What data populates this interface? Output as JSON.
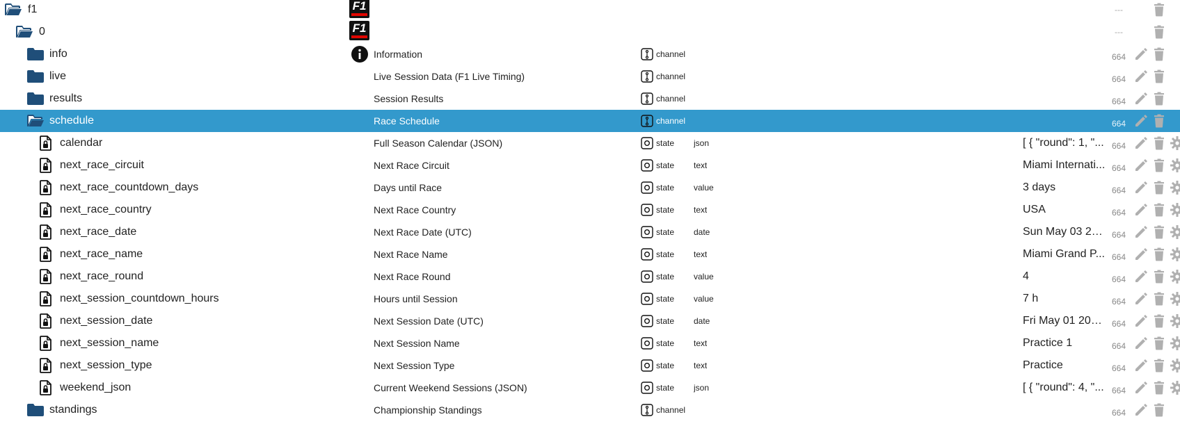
{
  "acl_placeholder": "---",
  "colors": {
    "selected_bg": "#3399cc",
    "folder": "#1f4e79",
    "icon_grey": "#b0b0b0"
  },
  "rows": [
    {
      "name": "f1",
      "level": 0,
      "kind": "folder-open",
      "logo": true,
      "acl": "---",
      "actions": "trash"
    },
    {
      "name": "0",
      "level": 1,
      "kind": "folder-open",
      "logo": true,
      "acl": "---",
      "actions": "trash"
    },
    {
      "name": "info",
      "level": 2,
      "kind": "folder",
      "info_icon": true,
      "desc": "Information",
      "role": "channel",
      "acl": "664",
      "actions": "edit"
    },
    {
      "name": "live",
      "level": 2,
      "kind": "folder",
      "desc": "Live Session Data (F1 Live Timing)",
      "role": "channel",
      "acl": "664",
      "actions": "edit"
    },
    {
      "name": "results",
      "level": 2,
      "kind": "folder",
      "desc": "Session Results",
      "role": "channel",
      "acl": "664",
      "actions": "edit"
    },
    {
      "name": "schedule",
      "level": 2,
      "kind": "folder-open",
      "selected": true,
      "desc": "Race Schedule",
      "role": "channel",
      "acl": "664",
      "actions": "edit"
    },
    {
      "name": "calendar",
      "level": 3,
      "kind": "file",
      "desc": "Full Season Calendar (JSON)",
      "role": "state",
      "type": "json",
      "value": "[ { \"round\": 1, \"...",
      "acl": "664",
      "actions": "state"
    },
    {
      "name": "next_race_circuit",
      "level": 3,
      "kind": "file",
      "desc": "Next Race Circuit",
      "role": "state",
      "type": "text",
      "value": "Miami Internati...",
      "acl": "664",
      "actions": "state"
    },
    {
      "name": "next_race_countdown_days",
      "level": 3,
      "kind": "file",
      "desc": "Days until Race",
      "role": "state",
      "type": "value",
      "value": "3 days",
      "acl": "664",
      "actions": "state"
    },
    {
      "name": "next_race_country",
      "level": 3,
      "kind": "file",
      "desc": "Next Race Country",
      "role": "state",
      "type": "text",
      "value": "USA",
      "acl": "664",
      "actions": "state"
    },
    {
      "name": "next_race_date",
      "level": 3,
      "kind": "file",
      "desc": "Next Race Date (UTC)",
      "role": "state",
      "type": "date",
      "value": "Sun May 03 20...",
      "acl": "664",
      "actions": "state"
    },
    {
      "name": "next_race_name",
      "level": 3,
      "kind": "file",
      "desc": "Next Race Name",
      "role": "state",
      "type": "text",
      "value": "Miami Grand P...",
      "acl": "664",
      "actions": "state"
    },
    {
      "name": "next_race_round",
      "level": 3,
      "kind": "file",
      "desc": "Next Race Round",
      "role": "state",
      "type": "value",
      "value": "4",
      "acl": "664",
      "actions": "state"
    },
    {
      "name": "next_session_countdown_hours",
      "level": 3,
      "kind": "file",
      "desc": "Hours until Session",
      "role": "state",
      "type": "value",
      "value": "7 h",
      "acl": "664",
      "actions": "state"
    },
    {
      "name": "next_session_date",
      "level": 3,
      "kind": "file",
      "desc": "Next Session Date (UTC)",
      "role": "state",
      "type": "date",
      "value": "Fri May 01 202...",
      "acl": "664",
      "actions": "state"
    },
    {
      "name": "next_session_name",
      "level": 3,
      "kind": "file",
      "desc": "Next Session Name",
      "role": "state",
      "type": "text",
      "value": "Practice 1",
      "acl": "664",
      "actions": "state"
    },
    {
      "name": "next_session_type",
      "level": 3,
      "kind": "file",
      "desc": "Next Session Type",
      "role": "state",
      "type": "text",
      "value": "Practice",
      "acl": "664",
      "actions": "state"
    },
    {
      "name": "weekend_json",
      "level": 3,
      "kind": "file",
      "desc": "Current Weekend Sessions (JSON)",
      "role": "state",
      "type": "json",
      "value": "[ { \"round\": 4, \"...",
      "acl": "664",
      "actions": "state"
    },
    {
      "name": "standings",
      "level": 2,
      "kind": "folder",
      "desc": "Championship Standings",
      "role": "channel",
      "acl": "664",
      "actions": "edit"
    }
  ]
}
